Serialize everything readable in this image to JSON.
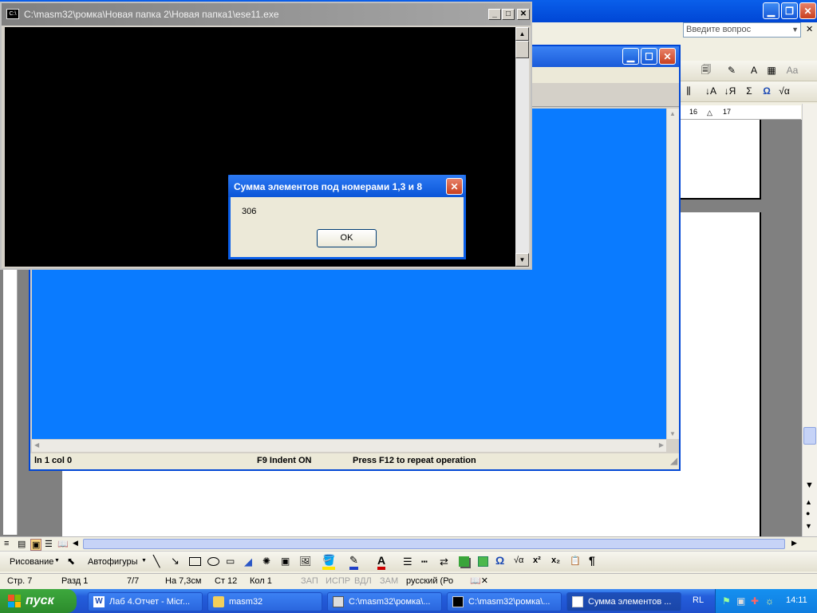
{
  "console": {
    "title": "C:\\masm32\\ромка\\Новая папка 2\\Новая папка1\\ese11.exe",
    "icon": "console-icon"
  },
  "dialog": {
    "title": "Сумма элементов под номерами 1,3 и 8",
    "message": "306",
    "ok_label": "OK"
  },
  "editor": {
    "status_line": "ln 1 col 0",
    "status_indent": "F9 Indent ON",
    "status_hint": "Press F12 to repeat operation"
  },
  "word": {
    "help_placeholder": "Введите вопрос",
    "ruler": [
      "16",
      "17"
    ],
    "drawing_label": "Рисование",
    "autoshapes_label": "Автофигуры",
    "status": {
      "page": "Стр. 7",
      "section": "Разд 1",
      "pages": "7/7",
      "at": "На 7,3см",
      "line": "Ст 12",
      "col": "Кол 1",
      "rec": "ЗАП",
      "trk": "ИСПР",
      "ext": "ВДЛ",
      "ovr": "ЗАМ",
      "lang": "русский (Ро"
    }
  },
  "taskbar": {
    "start_label": "пуск",
    "items": [
      {
        "label": "Лаб 4.Отчет - Micr..."
      },
      {
        "label": "masm32"
      },
      {
        "label": "C:\\masm32\\ромка\\..."
      },
      {
        "label": "C:\\masm32\\ромка\\..."
      },
      {
        "label": "Сумма элементов ..."
      }
    ],
    "lang": "RL",
    "clock": "14:11"
  }
}
